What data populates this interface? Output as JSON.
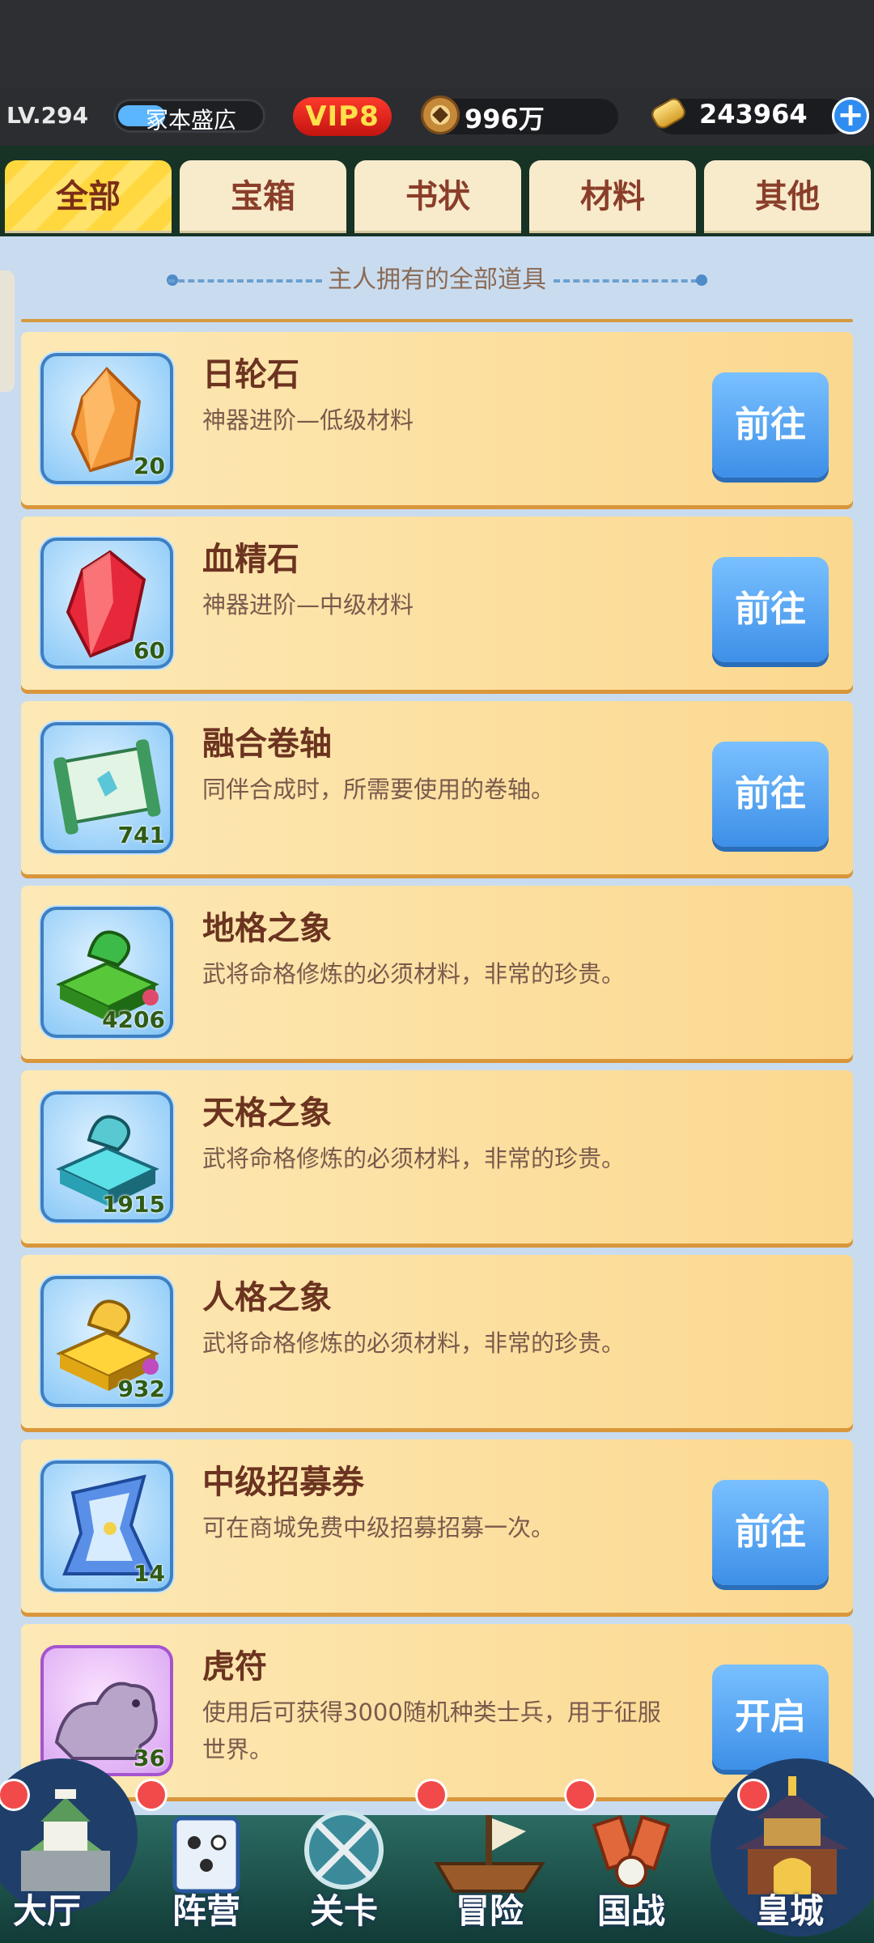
{
  "player": {
    "level": "LV.294",
    "name": "冢本盛広",
    "vip": "VIP8"
  },
  "currency": {
    "coins": "996万",
    "gold": "243964",
    "add_icon": "plus-icon"
  },
  "tabs": [
    {
      "label": "全部",
      "active": true
    },
    {
      "label": "宝箱",
      "active": false
    },
    {
      "label": "书状",
      "active": false
    },
    {
      "label": "材料",
      "active": false
    },
    {
      "label": "其他",
      "active": false
    }
  ],
  "section_title": "主人拥有的全部道具",
  "items": [
    {
      "name": "日轮石",
      "desc": "神器进阶—低级材料",
      "count": "20",
      "action": "前往",
      "icon": "orange-crystal-icon"
    },
    {
      "name": "血精石",
      "desc": "神器进阶—中级材料",
      "count": "60",
      "action": "前往",
      "icon": "red-crystal-icon"
    },
    {
      "name": "融合卷轴",
      "desc": "同伴合成时，所需要使用的卷轴。",
      "count": "741",
      "action": "前往",
      "icon": "scroll-icon"
    },
    {
      "name": "地格之象",
      "desc": "武将命格修炼的必须材料，非常的珍贵。",
      "count": "4206",
      "action": "",
      "icon": "green-seal-icon"
    },
    {
      "name": "天格之象",
      "desc": "武将命格修炼的必须材料，非常的珍贵。",
      "count": "1915",
      "action": "",
      "icon": "cyan-seal-icon"
    },
    {
      "name": "人格之象",
      "desc": "武将命格修炼的必须材料，非常的珍贵。",
      "count": "932",
      "action": "",
      "icon": "gold-seal-icon"
    },
    {
      "name": "中级招募券",
      "desc": "可在商城免费中级招募招募一次。",
      "count": "14",
      "action": "前往",
      "icon": "recruit-ticket-icon"
    },
    {
      "name": "虎符",
      "desc": "使用后可获得3000随机种类士兵，用于征服世界。",
      "count": "36",
      "action": "开启",
      "icon": "tiger-tally-icon"
    }
  ],
  "nav": [
    {
      "label": "大厅",
      "icon": "castle-icon"
    },
    {
      "label": "阵营",
      "icon": "scroll-board-icon"
    },
    {
      "label": "关卡",
      "icon": "crossed-swords-icon"
    },
    {
      "label": "冒险",
      "icon": "ship-icon"
    },
    {
      "label": "国战",
      "icon": "war-banners-icon"
    },
    {
      "label": "皇城",
      "icon": "palace-icon"
    }
  ],
  "colors": {
    "accent_blue": "#3d8fe8",
    "tab_active": "#ffd83f",
    "card": "#fbd88f",
    "badge_red": "#f24a4a"
  }
}
